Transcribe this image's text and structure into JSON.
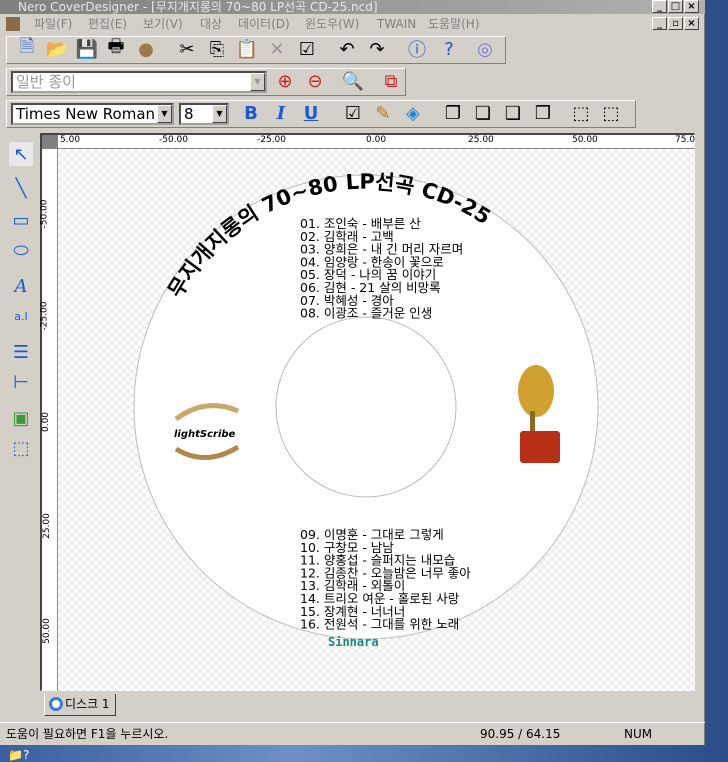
{
  "window": {
    "title": "Nero CoverDesigner - [무지개지롱의 70~80 LP선곡 CD-25.ncd]"
  },
  "menu": [
    "파일(F)",
    "편집(E)",
    "보기(V)",
    "대상",
    "데이터(D)",
    "윈도우(W)",
    "TWAIN",
    "도움말(H)"
  ],
  "toolbar1": [
    "new-icon",
    "open-icon",
    "save-icon",
    "print-icon",
    "lightscribe-icon",
    "cut-icon",
    "copy-icon",
    "paste-icon",
    "delete-icon",
    "properties-icon",
    "undo-icon",
    "redo-icon",
    "info-icon",
    "help-icon",
    "disc-icon"
  ],
  "paper_type": {
    "value": "일반 종이"
  },
  "font": {
    "family": "Times New Roman",
    "size": "8",
    "bold": "B",
    "italic": "I",
    "underline": "U"
  },
  "left_tools": [
    "select-icon",
    "line-icon",
    "rectangle-icon",
    "ellipse-icon",
    "artistic-text-icon",
    "text-box-icon",
    "track-list-icon",
    "tree-icon",
    "image-icon",
    "field-icon"
  ],
  "ruler": {
    "top": [
      "5.00",
      "-50.00",
      "-25.00",
      "0.00",
      "25.00",
      "50.00",
      "75.0"
    ],
    "left": [
      "-50.00",
      "-25.00",
      "0.00",
      "25.00",
      "50.00"
    ]
  },
  "disc": {
    "title": "무지개지롱의 70~80 LP선곡 CD-25",
    "tracks_top": [
      "01. 조인숙 - 배부른 산",
      "02. 김학래 - 고백",
      "03. 양희은 - 내 긴 머리 자르며",
      "04. 임양랑 - 한송이 꽃으로",
      "05. 장덕 - 나의 꿈 이야기",
      "06. 김현 - 21 살의 비망록",
      "07. 박혜성 - 경아",
      "08. 이광조 - 즐거운 인생"
    ],
    "tracks_bottom": [
      "09. 이명훈 - 그대로 그렇게",
      "10. 구창모 - 남남",
      "11. 양홍섭 - 슬퍼지는 내모습",
      "12. 김종찬 - 오늘밤은 너무 좋아",
      "13. 김학래 - 외톨이",
      "14. 트리오 여운 - 홀로된 사랑",
      "15. 장계현 - 너너너",
      "16. 전원석 - 그대를 위한 노래"
    ],
    "footer": "Sinnara",
    "logo": "lightScribe",
    "footer_color": "#1a8a7a"
  },
  "tab": {
    "label": "디스크 1"
  },
  "status": {
    "help": "도움이 필요하면 F1을 누르시오.",
    "coords": "90.95 / 64.15",
    "num": "NUM"
  }
}
